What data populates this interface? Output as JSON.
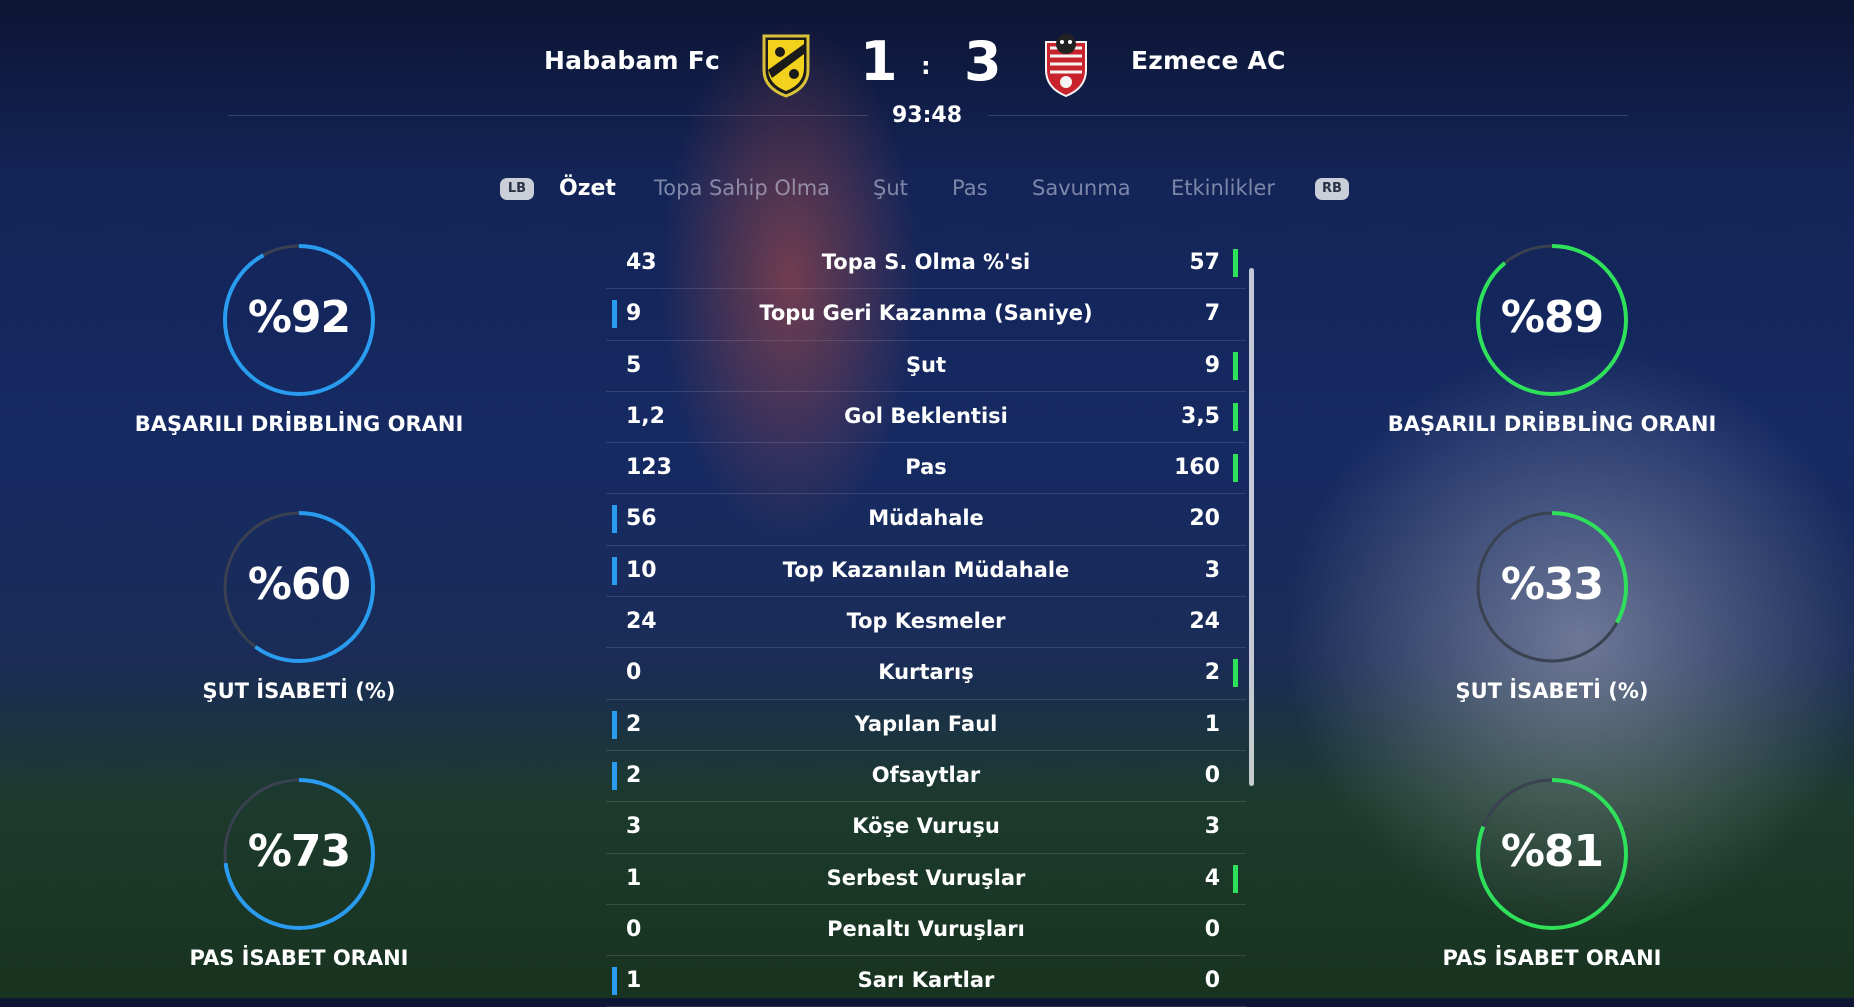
{
  "match": {
    "home_team": "Hababam Fc",
    "away_team": "Ezmece AC",
    "home_score": "1",
    "away_score": "3",
    "separator": ":",
    "clock": "93:48"
  },
  "tabs": {
    "lb": "LB",
    "rb": "RB",
    "items": [
      "Özet",
      "Topa Sahip Olma",
      "Şut",
      "Pas",
      "Savunma",
      "Etkinlikler"
    ],
    "active_index": 0
  },
  "left_rings": [
    {
      "value": "%92",
      "percent": 92,
      "label": "BAŞARILI DRİBBLİNG ORANI"
    },
    {
      "value": "%60",
      "percent": 60,
      "label": "ŞUT İSABETİ (%)"
    },
    {
      "value": "%73",
      "percent": 73,
      "label": "PAS İSABET ORANI"
    }
  ],
  "right_rings": [
    {
      "value": "%89",
      "percent": 89,
      "label": "BAŞARILI DRİBBLİNG ORANI"
    },
    {
      "value": "%33",
      "percent": 33,
      "label": "ŞUT İSABETİ (%)"
    },
    {
      "value": "%81",
      "percent": 81,
      "label": "PAS İSABET ORANI"
    }
  ],
  "colors": {
    "home_accent": "#2a9cf0",
    "away_accent": "#2fe05a",
    "ring_track": "#3a4150"
  },
  "stats": [
    {
      "label": "Topa S. Olma %'si",
      "home": "43",
      "away": "57",
      "leader": "away"
    },
    {
      "label": "Topu Geri Kazanma (Saniye)",
      "home": "9",
      "away": "7",
      "leader": "home"
    },
    {
      "label": "Şut",
      "home": "5",
      "away": "9",
      "leader": "away"
    },
    {
      "label": "Gol Beklentisi",
      "home": "1,2",
      "away": "3,5",
      "leader": "away"
    },
    {
      "label": "Pas",
      "home": "123",
      "away": "160",
      "leader": "away"
    },
    {
      "label": "Müdahale",
      "home": "56",
      "away": "20",
      "leader": "home"
    },
    {
      "label": "Top Kazanılan Müdahale",
      "home": "10",
      "away": "3",
      "leader": "home"
    },
    {
      "label": "Top Kesmeler",
      "home": "24",
      "away": "24",
      "leader": "none"
    },
    {
      "label": "Kurtarış",
      "home": "0",
      "away": "2",
      "leader": "away"
    },
    {
      "label": "Yapılan Faul",
      "home": "2",
      "away": "1",
      "leader": "home"
    },
    {
      "label": "Ofsaytlar",
      "home": "2",
      "away": "0",
      "leader": "home"
    },
    {
      "label": "Köşe Vuruşu",
      "home": "3",
      "away": "3",
      "leader": "none"
    },
    {
      "label": "Serbest Vuruşlar",
      "home": "1",
      "away": "4",
      "leader": "away"
    },
    {
      "label": "Penaltı Vuruşları",
      "home": "0",
      "away": "0",
      "leader": "none"
    },
    {
      "label": "Sarı Kartlar",
      "home": "1",
      "away": "0",
      "leader": "home"
    }
  ]
}
